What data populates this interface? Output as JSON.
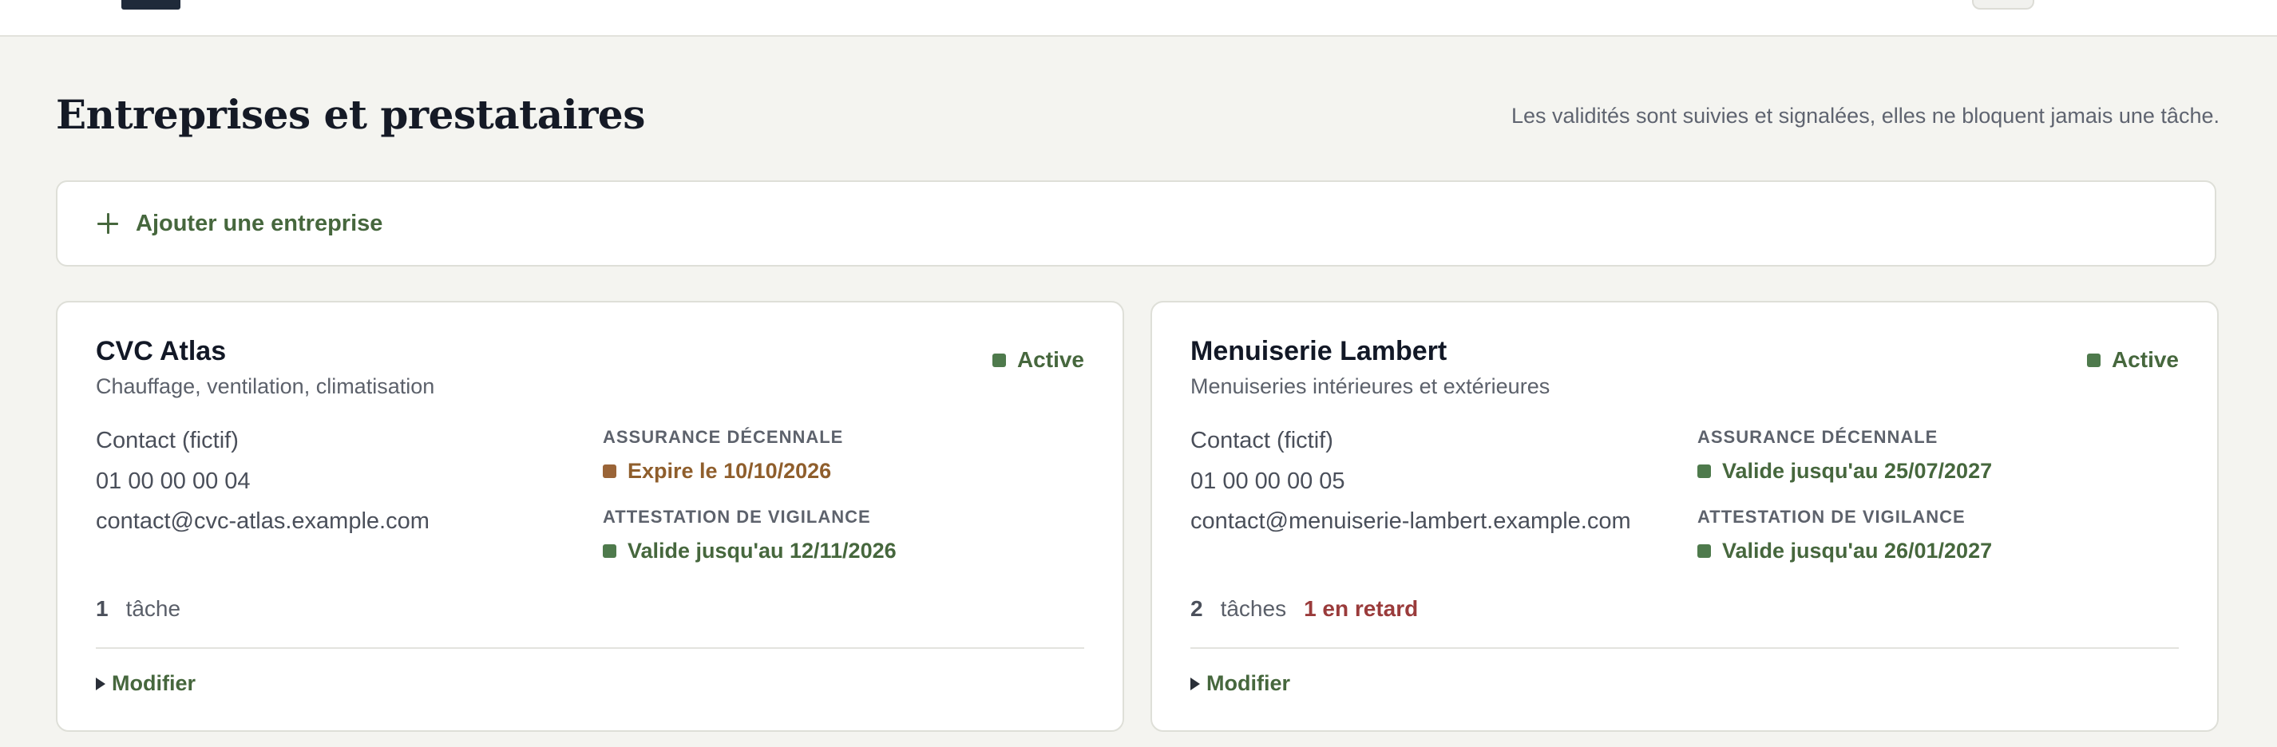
{
  "page": {
    "title": "Entreprises et prestataires",
    "note": "Les validités sont suivies et signalées, elles ne bloquent jamais une tâche."
  },
  "add_company": {
    "label": "Ajouter une entreprise",
    "icon": "plus-icon"
  },
  "companies": [
    {
      "name": "CVC Atlas",
      "subtitle": "Chauffage, ventilation, climatisation",
      "status": "Active",
      "status_color": "#4e7a4c",
      "contact_name": "Contact (fictif)",
      "phone": "01 00 00 00 04",
      "email": "contact@cvc-atlas.example.com",
      "insurance_label": "ASSURANCE DÉCENNALE",
      "insurance_value": "Expire le 10/10/2026",
      "insurance_state": "warning",
      "vigilance_label": "ATTESTATION DE VIGILANCE",
      "vigilance_value": "Valide jusqu'au 12/11/2026",
      "vigilance_state": "valid",
      "task_count": "1",
      "task_word": "tâche",
      "late": "",
      "edit_label": "Modifier"
    },
    {
      "name": "Menuiserie Lambert",
      "subtitle": "Menuiseries intérieures et extérieures",
      "status": "Active",
      "status_color": "#4e7a4c",
      "contact_name": "Contact (fictif)",
      "phone": "01 00 00 00 05",
      "email": "contact@menuiserie-lambert.example.com",
      "insurance_label": "ASSURANCE DÉCENNALE",
      "insurance_value": "Valide jusqu'au 25/07/2027",
      "insurance_state": "valid",
      "vigilance_label": "ATTESTATION DE VIGILANCE",
      "vigilance_value": "Valide jusqu'au 26/01/2027",
      "vigilance_state": "valid",
      "task_count": "2",
      "task_word": "tâches",
      "late": "1 en retard",
      "edit_label": "Modifier"
    }
  ],
  "colors": {
    "accent_green": "#46673d",
    "warning_amber": "#8f5e2c",
    "late_red": "#9a3b3b",
    "background": "#f4f4f0"
  }
}
